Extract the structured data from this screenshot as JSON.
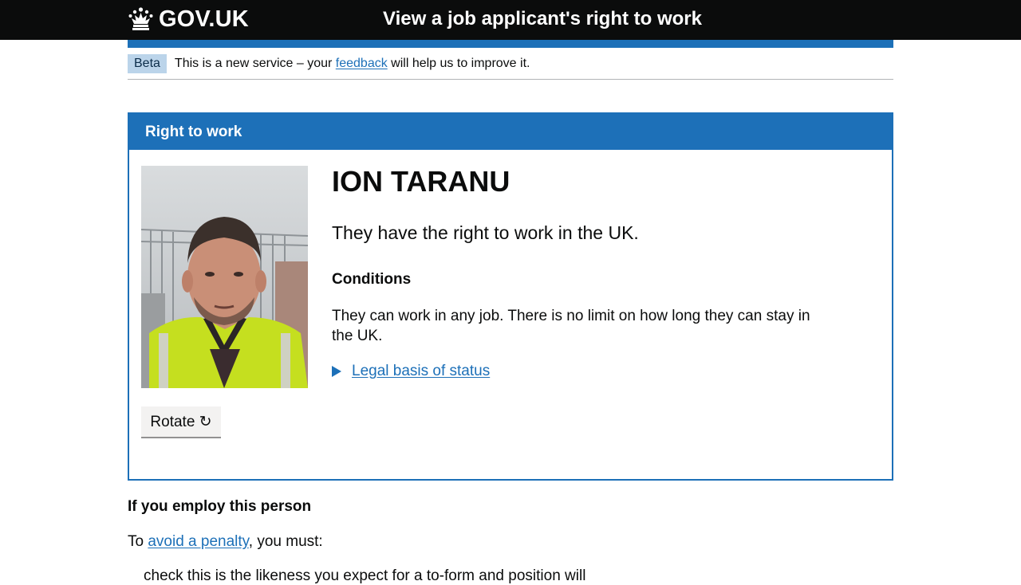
{
  "header": {
    "logo_text": "GOV.UK",
    "service_name": "View a job applicant's right to work",
    "brand_color": "#1d70b8",
    "crown_icon": "crown-icon"
  },
  "phase_banner": {
    "tag": "Beta",
    "text_before": "This is a new service – your ",
    "link": "feedback",
    "text_after": " will help us to improve it."
  },
  "panel": {
    "title": "Right to work",
    "name": "ION TARANU",
    "status": "They have the right to work in the UK.",
    "conditions_heading": "Conditions",
    "conditions_text": "They can work in any job. There is no limit on how long they can stay in the UK.",
    "details_link": "Legal basis of status",
    "rotate_button": "Rotate ↻"
  },
  "below": {
    "employ_heading": "If you employ this person",
    "penalty_before": "To ",
    "penalty_link": "avoid a penalty",
    "penalty_after": ", you must:",
    "cut_off_text": "check this is the likeness you expect for a to-form and position will"
  }
}
